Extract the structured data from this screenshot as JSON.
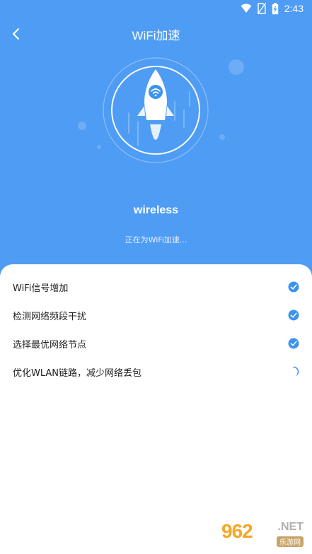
{
  "status_bar": {
    "time": "2:43",
    "icons": [
      "wifi-icon",
      "no-sim-icon",
      "battery-charging-icon"
    ]
  },
  "header": {
    "title": "WiFi加速",
    "back_icon": "chevron-left-icon"
  },
  "network": {
    "name": "wireless",
    "status": "正在为WiFi加速..."
  },
  "tasks": [
    {
      "label": "WiFi信号增加",
      "status": "done"
    },
    {
      "label": "检测网络频段干扰",
      "status": "done"
    },
    {
      "label": "选择最优网络节点",
      "status": "done"
    },
    {
      "label": "优化WLAN链路，减少网络丢包",
      "status": "loading"
    }
  ],
  "watermark": {
    "logo": "962",
    "domain": ".NET",
    "subtitle": "乐游网"
  },
  "colors": {
    "background": "#4f9cf5",
    "accent": "#3c93ef",
    "sheet": "#ffffff"
  }
}
